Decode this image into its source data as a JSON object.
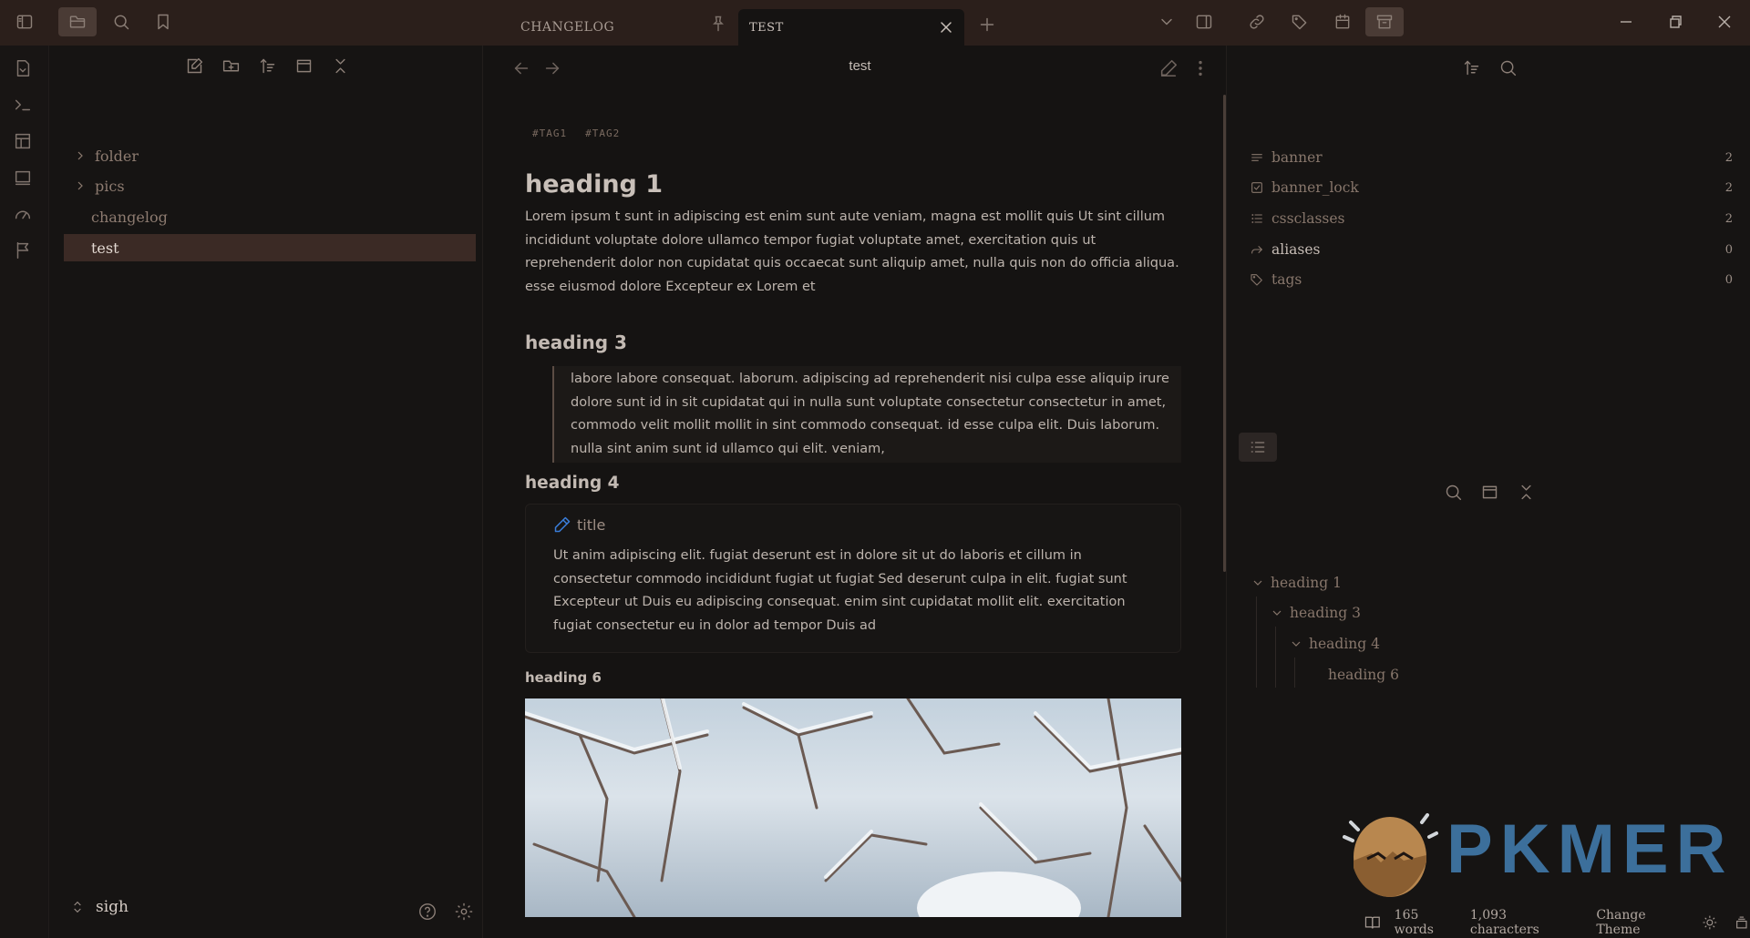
{
  "titlebar": {
    "tabs": [
      {
        "label": "CHANGELOG"
      },
      {
        "label": "TEST"
      }
    ]
  },
  "file_tree": [
    {
      "name": "folder",
      "type": "folder"
    },
    {
      "name": "pics",
      "type": "folder"
    },
    {
      "name": "changelog",
      "type": "file"
    },
    {
      "name": "test",
      "type": "file",
      "selected": true
    }
  ],
  "vault": {
    "name": "sigh"
  },
  "editor": {
    "title": "test",
    "tags": [
      "#TAG1",
      "#TAG2"
    ],
    "h1": "heading 1",
    "para1": "Lorem ipsum t sunt in adipiscing est enim sunt aute veniam, magna est mollit quis Ut sint cillum incididunt voluptate dolore ullamco tempor fugiat voluptate amet, exercitation quis ut reprehenderit dolor non cupidatat quis occaecat sunt aliquip amet, nulla quis non do officia aliqua. esse eiusmod dolore Excepteur ex Lorem et",
    "h3": "heading 3",
    "quote": "labore labore consequat. laborum. adipiscing ad reprehenderit nisi culpa esse aliquip irure dolore sunt id in sit cupidatat qui in nulla sunt voluptate consectetur consectetur in amet, commodo velit mollit mollit in sint commodo consequat. id esse culpa elit. Duis laborum. nulla sint anim sunt id ullamco qui elit. veniam,",
    "h4": "heading 4",
    "callout_title": "title",
    "callout_body": "Ut anim adipiscing elit. fugiat deserunt est in dolore sit ut do laboris et cillum in consectetur commodo incididunt fugiat ut fugiat Sed deserunt culpa in elit. fugiat sunt Excepteur ut Duis eu adipiscing consequat. enim sint cupidatat mollit elit. exercitation fugiat consectetur eu in dolor ad tempor Duis ad",
    "h6": "heading 6"
  },
  "properties": [
    {
      "name": "banner",
      "icon": "text-icon",
      "count": "2"
    },
    {
      "name": "banner_lock",
      "icon": "checkbox-icon",
      "count": "2"
    },
    {
      "name": "cssclasses",
      "icon": "list-icon",
      "count": "2"
    },
    {
      "name": "aliases",
      "icon": "forward-icon",
      "count": "0"
    },
    {
      "name": "tags",
      "icon": "tags-icon",
      "count": "0"
    }
  ],
  "outline": [
    {
      "label": "heading 1",
      "level": 1
    },
    {
      "label": "heading 3",
      "level": 2
    },
    {
      "label": "heading 4",
      "level": 3
    },
    {
      "label": "heading 6",
      "level": 4
    }
  ],
  "status": {
    "words": "165 words",
    "chars": "1,093 characters",
    "theme": "Change Theme"
  },
  "logo": {
    "text": "PKMER"
  }
}
